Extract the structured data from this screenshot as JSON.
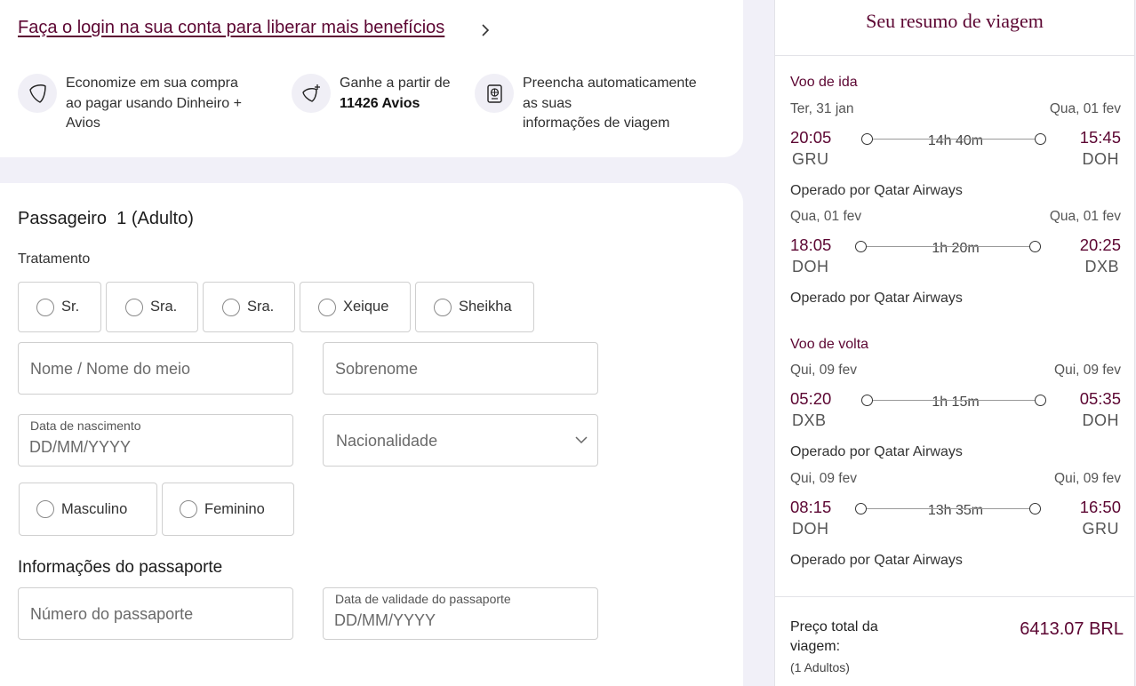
{
  "login": {
    "link_text": "Faça o login na sua conta para liberar mais benefícios",
    "benefits": [
      {
        "icon": "avios-wallet-icon",
        "line1": "Economize em sua compra",
        "line2": "ao pagar usando Dinheiro +",
        "line3": "Avios"
      },
      {
        "icon": "avios-plus-icon",
        "line1": "Ganhe a partir de",
        "line2": "11426 Avios"
      },
      {
        "icon": "passport-icon",
        "line1": "Preencha automaticamente",
        "line2": "as suas",
        "line3": "informações de viagem"
      }
    ]
  },
  "passenger": {
    "title": "Passageiro  1 (Adulto)",
    "treatment_label": "Tratamento",
    "titles": [
      "Sr.",
      "Sra.",
      "Sra.",
      "Xeique",
      "Sheikha"
    ],
    "first_name_placeholder": "Nome / Nome do meio",
    "last_name_placeholder": "Sobrenome",
    "dob_label": "Data de nascimento",
    "dob_placeholder": "DD/MM/YYYY",
    "nationality_placeholder": "Nacionalidade",
    "genders": [
      "Masculino",
      "Feminino"
    ],
    "passport_section": "Informações do passaporte",
    "passport_number_placeholder": "Número do passaporte",
    "passport_expiry_label": "Data de validade do passaporte",
    "passport_expiry_placeholder": "DD/MM/YYYY"
  },
  "summary": {
    "title": "Seu resumo de viagem",
    "outbound_label": "Voo de ida",
    "return_label": "Voo de volta",
    "segments": [
      {
        "dep_date": "Ter, 31 jan",
        "arr_date": "Qua, 01 fev",
        "dep_time": "20:05",
        "arr_time": "15:45",
        "dep_airport": "GRU",
        "arr_airport": "DOH",
        "duration": "14h 40m",
        "operator": "Operado por Qatar Airways"
      },
      {
        "dep_date": "Qua, 01 fev",
        "arr_date": "Qua, 01 fev",
        "dep_time": "18:05",
        "arr_time": "20:25",
        "dep_airport": "DOH",
        "arr_airport": "DXB",
        "duration": "1h 20m",
        "operator": "Operado por Qatar Airways"
      },
      {
        "dep_date": "Qui, 09 fev",
        "arr_date": "Qui, 09 fev",
        "dep_time": "05:20",
        "arr_time": "05:35",
        "dep_airport": "DXB",
        "arr_airport": "DOH",
        "duration": "1h 15m",
        "operator": "Operado por Qatar Airways"
      },
      {
        "dep_date": "Qui, 09 fev",
        "arr_date": "Qui, 09 fev",
        "dep_time": "08:15",
        "arr_time": "16:50",
        "dep_airport": "DOH",
        "arr_airport": "GRU",
        "duration": "13h 35m",
        "operator": "Operado por Qatar Airways"
      }
    ],
    "price_label_1": "Preço total da",
    "price_label_2": "viagem:",
    "price_sub": "(1 Adultos)",
    "price_value": "6413.07 BRL"
  },
  "colors": {
    "brand": "#5c0632",
    "background": "#f1f0f8"
  }
}
